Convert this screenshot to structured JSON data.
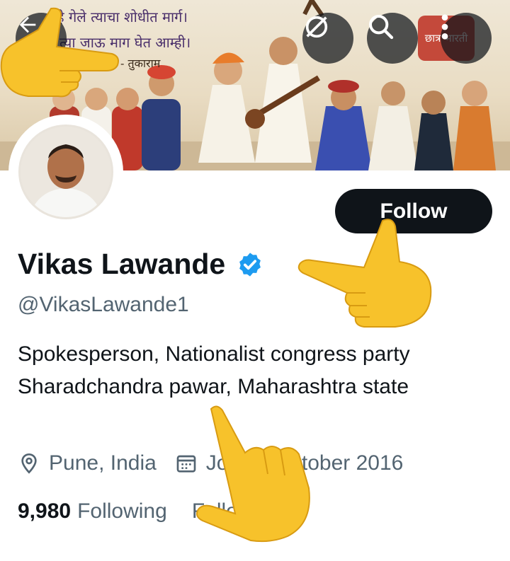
{
  "banner": {
    "text_lines": [
      "हे गेले त्याचा शोधीत मार्ग।",
      "त्या जाऊ माग घेत आम्ही।",
      "- तुकाराम"
    ],
    "stamp_text": "छात्र भारती"
  },
  "header": {
    "back_icon": "arrow-left-icon",
    "grok_icon": "grok-icon",
    "search_icon": "search-icon",
    "more_icon": "more-vertical-icon"
  },
  "profile": {
    "display_name": "Vikas Lawande",
    "handle": "@VikasLawande1",
    "verified_color": "#1d9bf0",
    "bio": "Spokesperson, Nationalist congress party Sharadchandra pawar, Maharashtra state",
    "location": "Pune, India",
    "joined": "Joined October 2016",
    "following_count": "9,980",
    "following_label": "Following",
    "followers_count": "",
    "followers_label": "Followers"
  },
  "actions": {
    "follow_label": "Follow"
  },
  "overlays": {
    "hand_icon": "backhand-index-pointing-emoji"
  },
  "colors": {
    "primary_text": "#0f1419",
    "secondary_text": "#536471",
    "button_bg": "#0f1419",
    "accent": "#1d9bf0"
  }
}
